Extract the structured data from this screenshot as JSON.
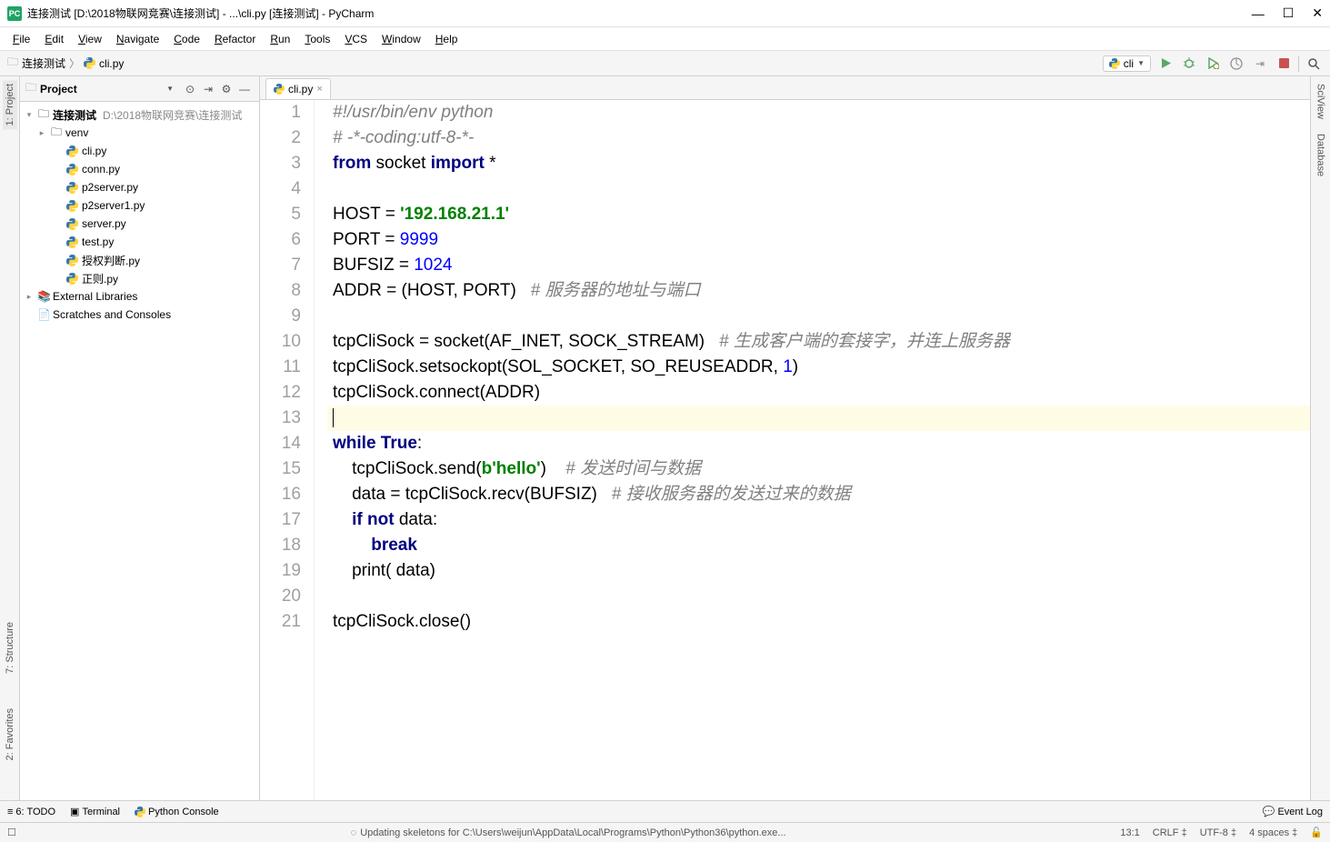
{
  "title": "连接测试 [D:\\2018物联网竞赛\\连接测试] - ...\\cli.py [连接测试] - PyCharm",
  "menu": [
    "File",
    "Edit",
    "View",
    "Navigate",
    "Code",
    "Refactor",
    "Run",
    "Tools",
    "VCS",
    "Window",
    "Help"
  ],
  "breadcrumb": {
    "folder": "连接测试",
    "file": "cli.py"
  },
  "run_config": "cli",
  "project_header": "Project",
  "tree": {
    "root": {
      "name": "连接测试",
      "path": "D:\\2018物联网竞赛\\连接测试"
    },
    "venv": "venv",
    "files": [
      "cli.py",
      "conn.py",
      "p2server.py",
      "p2server1.py",
      "server.py",
      "test.py",
      "授权判断.py",
      "正则.py"
    ],
    "external": "External Libraries",
    "scratches": "Scratches and Consoles"
  },
  "tab": "cli.py",
  "code_lines": [
    {
      "n": 1,
      "html": "<span class='comment'>#!/usr/bin/env python</span>"
    },
    {
      "n": 2,
      "html": "<span class='comment'># -*-coding:utf-8-*-</span>"
    },
    {
      "n": 3,
      "html": "<span class='kw'>from</span> socket <span class='kw'>import</span> *"
    },
    {
      "n": 4,
      "html": ""
    },
    {
      "n": 5,
      "html": "HOST = <span class='str'>'192.168.21.1'</span>"
    },
    {
      "n": 6,
      "html": "PORT = <span class='num'>9999</span>"
    },
    {
      "n": 7,
      "html": "BUFSIZ = <span class='num'>1024</span>"
    },
    {
      "n": 8,
      "html": "ADDR = (HOST, PORT)   <span class='comment'># 服务器的地址与端口</span>"
    },
    {
      "n": 9,
      "html": ""
    },
    {
      "n": 10,
      "html": "tcpCliSock = socket(AF_INET, SOCK_STREAM)   <span class='comment'># 生成客户端的套接字，并连上服务器</span>"
    },
    {
      "n": 11,
      "html": "tcpCliSock.setsockopt(SOL_SOCKET, SO_REUSEADDR, <span class='num'>1</span>)"
    },
    {
      "n": 12,
      "html": "tcpCliSock.connect(ADDR)"
    },
    {
      "n": 13,
      "html": "<span class='caret'></span>",
      "current": true
    },
    {
      "n": 14,
      "html": "<span class='kw'>while True</span>:"
    },
    {
      "n": 15,
      "html": "    tcpCliSock.send(<span class='bytes'>b'hello'</span>)    <span class='comment'># 发送时间与数据</span>"
    },
    {
      "n": 16,
      "html": "    data = tcpCliSock.recv(BUFSIZ)   <span class='comment'># 接收服务器的发送过来的数据</span>"
    },
    {
      "n": 17,
      "html": "    <span class='kw'>if not</span> data:"
    },
    {
      "n": 18,
      "html": "        <span class='kw'>break</span>"
    },
    {
      "n": 19,
      "html": "    print( data)"
    },
    {
      "n": 20,
      "html": ""
    },
    {
      "n": 21,
      "html": "tcpCliSock.close()"
    }
  ],
  "bottom": {
    "todo": "6: TODO",
    "terminal": "Terminal",
    "python_console": "Python Console",
    "event_log": "Event Log"
  },
  "status": {
    "msg": "Updating skeletons for C:\\Users\\weijun\\AppData\\Local\\Programs\\Python\\Python36\\python.exe...",
    "pos": "13:1",
    "crlf": "CRLF",
    "enc": "UTF-8",
    "indent": "4 spaces"
  },
  "left_tabs": [
    "1: Project",
    "7: Structure",
    "2: Favorites"
  ],
  "right_tabs": [
    "SciView",
    "Database"
  ]
}
